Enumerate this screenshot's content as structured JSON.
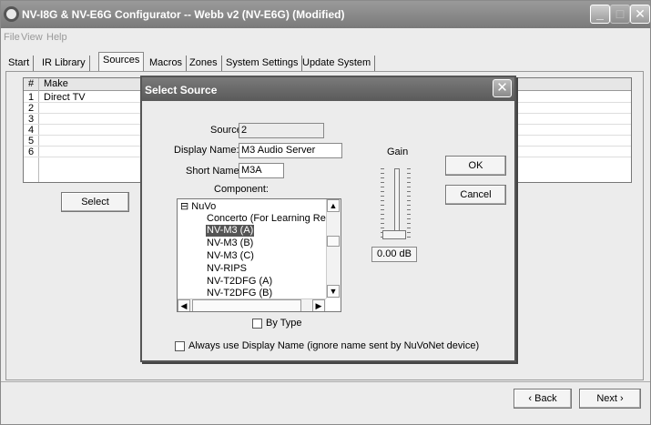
{
  "window": {
    "title": "NV-I8G & NV-E6G Configurator -- Webb v2 (NV-E6G) (Modified)",
    "minimize": "_",
    "close": "✕"
  },
  "menu": [
    "File",
    "View",
    "Help"
  ],
  "tabs": [
    "Start",
    "IR Library",
    "Sources",
    "Macros",
    "Zones",
    "System Settings",
    "Update System"
  ],
  "active_tab": "Sources",
  "grid": {
    "col_num": "#",
    "col_make": "Make",
    "rows": [
      {
        "num": "1",
        "make": "Direct TV"
      },
      {
        "num": "2",
        "make": ""
      },
      {
        "num": "3",
        "make": ""
      },
      {
        "num": "4",
        "make": ""
      },
      {
        "num": "5",
        "make": ""
      },
      {
        "num": "6",
        "make": ""
      }
    ]
  },
  "buttons": {
    "select": "Select",
    "back": "‹ Back",
    "next": "Next ›"
  },
  "dialog": {
    "title": "Select Source",
    "close": "✕",
    "source_label": "Source:",
    "source_value": "2",
    "display_name_label": "Display Name:",
    "display_name_value": "M3 Audio Server",
    "short_name_label": "Short Name:",
    "short_name_value": "M3A",
    "component_label": "Component:",
    "tree": {
      "root": "NuVo",
      "expander": "⊟",
      "items": [
        "Concerto (For Learning Remo",
        "NV-M3 (A)",
        "NV-M3 (B)",
        "NV-M3 (C)",
        "NV-RIPS",
        "NV-T2DFG (A)",
        "NV-T2DFG (B)"
      ],
      "selected": "NV-M3 (A)"
    },
    "by_type_label": "By Type",
    "gain_label": "Gain",
    "gain_value": "0.00 dB",
    "gain_level": 0.0,
    "ok": "OK",
    "cancel": "Cancel",
    "always_use_label": "Always use Display Name (ignore name sent by NuVoNet device)"
  }
}
